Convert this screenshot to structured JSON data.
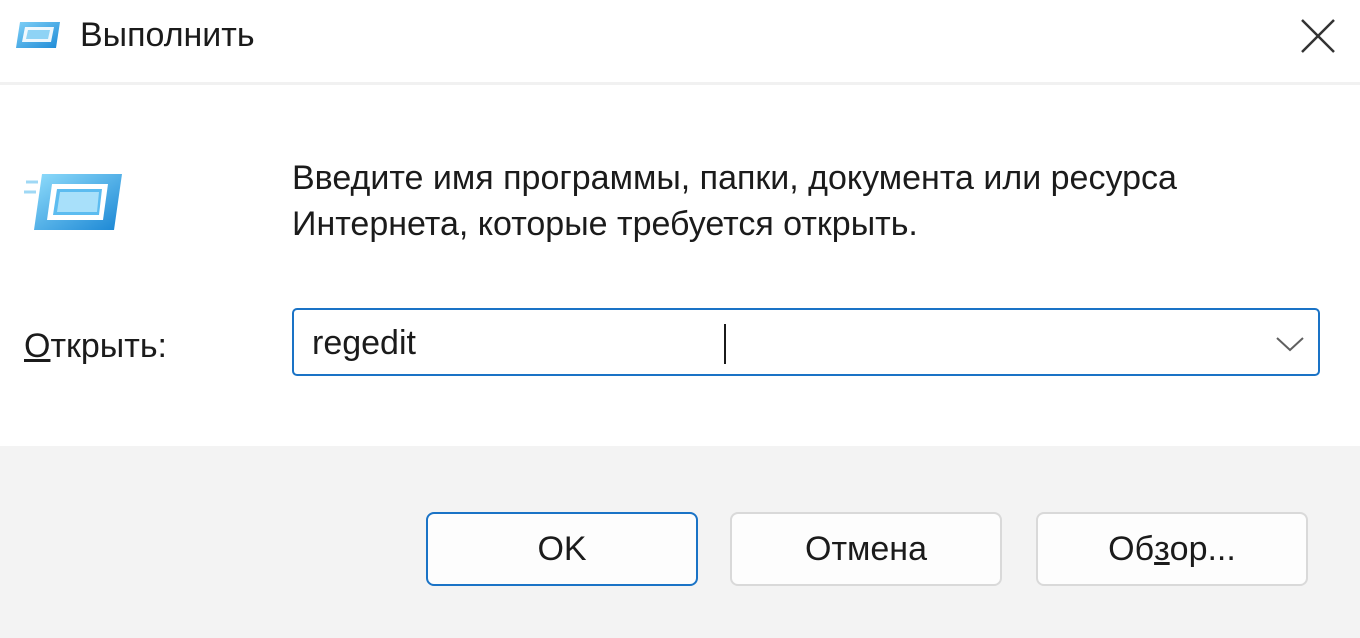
{
  "window": {
    "title": "Выполнить",
    "title_icon": "run-icon",
    "close_icon": "close-icon"
  },
  "dialog": {
    "icon": "run-icon",
    "description_line1": "Введите имя программы, папки, документа или ресурса",
    "description_line2": "Интернета, которые требуется открыть.",
    "open_label_accel": "О",
    "open_label_rest": "ткрыть:",
    "open_value": "regedit",
    "dropdown_icon": "chevron-down-icon"
  },
  "buttons": {
    "ok_label": "OK",
    "cancel_label": "Отмена",
    "browse_label_before": "Об",
    "browse_label_accel": "з",
    "browse_label_after": "ор..."
  },
  "colors": {
    "accent": "#1a73c6",
    "footer_bg": "#f3f3f3",
    "icon_blue": "#3aa0e0"
  }
}
